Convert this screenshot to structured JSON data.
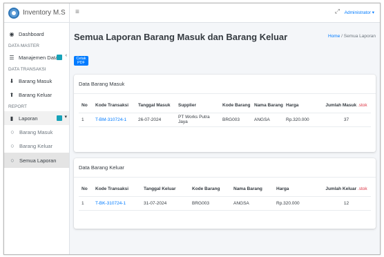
{
  "app": {
    "title": "Inventory M.S"
  },
  "topbar": {
    "user_label": "Administrator ▾"
  },
  "sidebar": {
    "dashboard": "Dashboard",
    "master_header": "DATA MASTER",
    "manajemen": "Manajemen Data",
    "trans_header": "DATA TRANSAKSI",
    "barang_masuk": "Barang Masuk",
    "barang_keluar": "Barang Keluar",
    "report_header": "REPORT",
    "laporan": "Laporan",
    "sub_masuk": "Barang Masuk",
    "sub_keluar": "Barang Keluar",
    "sub_semua": "Semua Laporan"
  },
  "page": {
    "title": "Semua Laporan Barang Masuk dan Barang Keluar",
    "crumb_home": "Home",
    "crumb_sep": " / ",
    "crumb_current": "Semua Laporan",
    "pdf_button": "Cetak PDF"
  },
  "masuk": {
    "title": "Data Barang Masuk",
    "headers": {
      "no": "No",
      "kode": "Kode Transaksi",
      "tanggal": "Tanggal Masuk",
      "supplier": "Supplier",
      "kode_barang": "Kode Barang",
      "nama": "Nama Barang",
      "harga": "Harga",
      "jumlah": "Jumlah Masuk",
      "unit": " .stok"
    },
    "rows": [
      {
        "no": "1",
        "kode": "T-BM-310724-1",
        "tanggal": "26-07-2024",
        "supplier": "PT Works Putra Jaya",
        "kode_barang": "BRG003",
        "nama": "ANGSA",
        "harga": "Rp.320.000",
        "jumlah": "37"
      }
    ]
  },
  "keluar": {
    "title": "Data Barang Keluar",
    "headers": {
      "no": "No",
      "kode": "Kode Transaksi",
      "tanggal": "Tanggal Keluar",
      "kode_barang": "Kode Barang",
      "nama": "Nama Barang",
      "harga": "Harga",
      "jumlah": "Jumlah Keluar",
      "unit": " .stok"
    },
    "rows": [
      {
        "no": "1",
        "kode": "T-BK-310724-1",
        "tanggal": "31-07-2024",
        "kode_barang": "BRG003",
        "nama": "ANGSA",
        "harga": "Rp.320.000",
        "jumlah": "12"
      }
    ]
  },
  "colors": {
    "accent": "#007bff",
    "badge": "#17a2b8",
    "stok": "#dc3545"
  }
}
